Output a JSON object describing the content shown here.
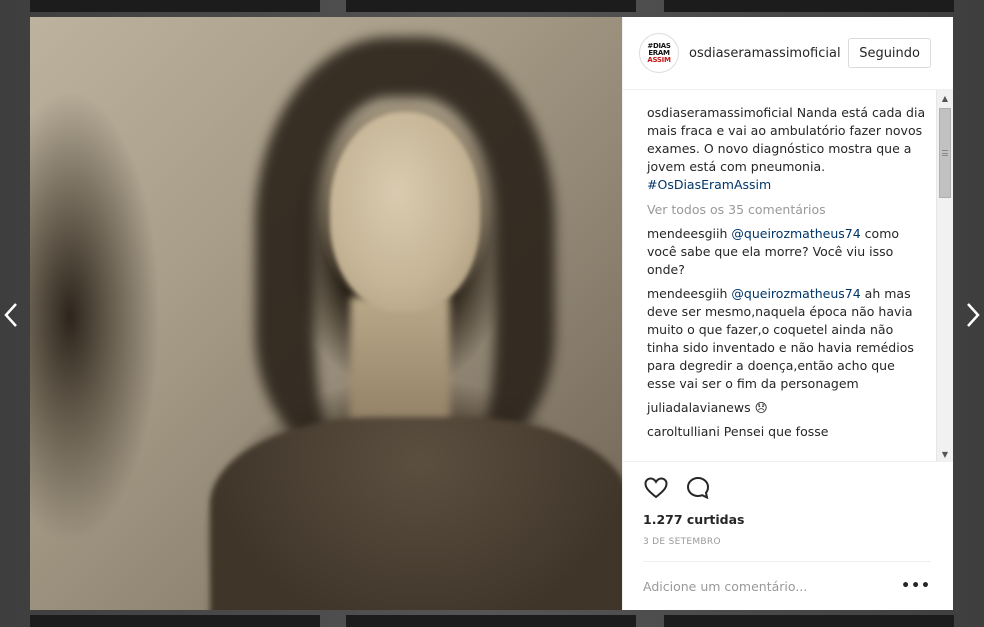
{
  "post": {
    "username": "osdiaseramassimoficial",
    "follow_label": "Seguindo",
    "avatar_lines": [
      "#DIAS",
      "ERAM",
      "ASSIM"
    ],
    "caption": {
      "user": "osdiaseramassimoficial",
      "text": " Nanda está cada dia mais fraca e vai ao ambulatório fazer novos exames. O novo diagnóstico mostra que a jovem está com pneumonia. ",
      "hashtag": "#OsDiasEramAssim"
    },
    "view_all": "Ver todos os 35 comentários",
    "comments": [
      {
        "user": "mendeesgiih",
        "mention": "@queirozmatheus74",
        "text": " como você sabe que ela morre? Você viu isso onde?"
      },
      {
        "user": "mendeesgiih",
        "mention": "@queirozmatheus74",
        "text": " ah mas deve ser mesmo,naquela época não havia muito o que fazer,o coquetel ainda não tinha sido inventado e não havia remédios para degredir a doença,então acho que esse vai ser o fim da personagem"
      },
      {
        "user": "juliadalavianews",
        "mention": "",
        "text": " 😞"
      },
      {
        "user": "caroltulliani",
        "mention": "",
        "text": " Pensei que fosse"
      }
    ],
    "likes": "1.277 curtidas",
    "date": "3 DE SETEMBRO",
    "comment_placeholder": "Adicione um comentário...",
    "more_label": "•••",
    "icons": {
      "like": "heart-icon",
      "comment": "comment-bubble-icon",
      "prev": "chevron-left-icon",
      "next": "chevron-right-icon"
    }
  }
}
